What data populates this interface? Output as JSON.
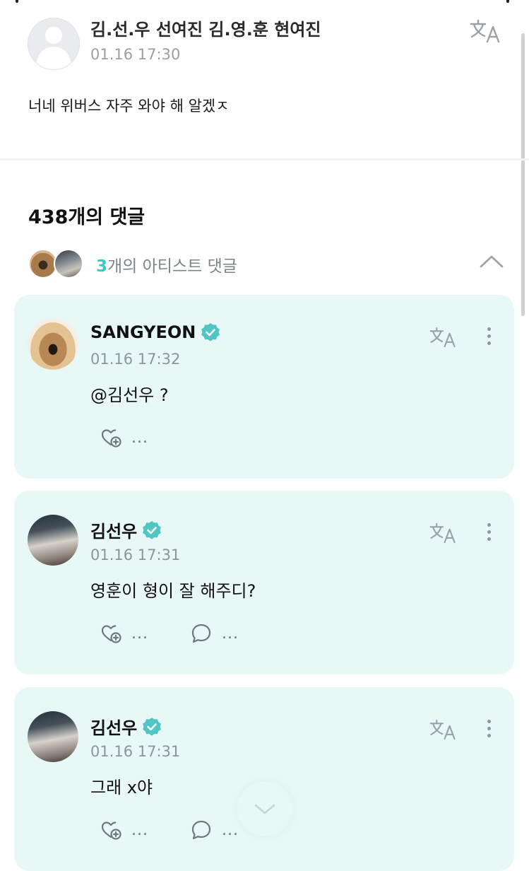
{
  "post": {
    "author": "김.선.우 선여진 김.영.훈 현여진",
    "time": "01.16 17:30",
    "text": "너네 위버스 자주 와야 해  알겠ㅈ"
  },
  "comments_header": {
    "count_label": "438개의 댓글",
    "artist_count": "3",
    "artist_label": "개의 아티스트 댓글"
  },
  "comments": [
    {
      "author": "SANGYEON",
      "time": "01.16 17:32",
      "text": "@김선우 ?",
      "like_label": "...",
      "reply_label": ""
    },
    {
      "author": "김선우",
      "time": "01.16 17:31",
      "text": "영훈이 형이 잘 해주디?",
      "like_label": "...",
      "reply_label": "..."
    },
    {
      "author": "김선우",
      "time": "01.16 17:31",
      "text": "그래 x야",
      "like_label": "...",
      "reply_label": "..."
    }
  ],
  "colors": {
    "accent": "#3ec7c3",
    "card_bg": "#e8f8f6",
    "verified": "#4fc6c4",
    "muted": "#8d959c"
  },
  "icons": [
    "translate-icon",
    "verified-badge-icon",
    "more-vertical-icon",
    "heart-plus-icon",
    "comment-bubble-icon",
    "chevron-up-icon",
    "chevron-down-icon",
    "default-avatar-icon"
  ]
}
